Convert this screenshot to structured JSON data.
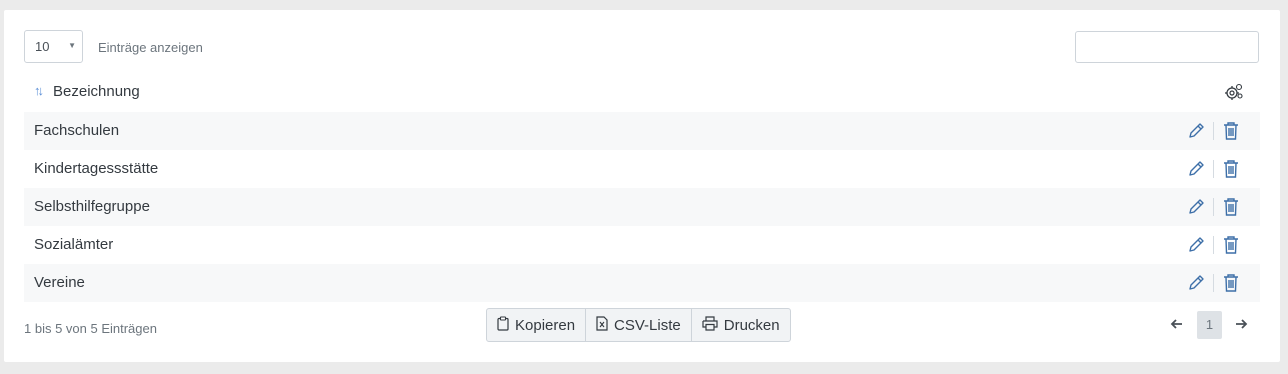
{
  "table_controls": {
    "page_length_value": "10",
    "page_length_label": "Einträge anzeigen",
    "search_value": ""
  },
  "table": {
    "column_header": "Bezeichnung",
    "rows": [
      "Fachschulen",
      "Kindertagessstätte",
      "Selbsthilfegruppe",
      "Sozialämter",
      "Vereine"
    ]
  },
  "footer": {
    "info": "1 bis 5 von 5 Einträgen",
    "buttons": {
      "copy": "Kopieren",
      "csv": "CSV-Liste",
      "print": "Drucken"
    },
    "current_page": "1"
  },
  "colors": {
    "accent_icon": "#3d6fa8",
    "row_stripe": "#f7f8f9",
    "sort_icon": "#5b8ed6"
  },
  "icons": [
    "sort-icon",
    "settings-icon",
    "edit-icon",
    "trash-icon",
    "copy-icon",
    "csv-icon",
    "print-icon",
    "arrow-left-icon",
    "arrow-right-icon"
  ]
}
